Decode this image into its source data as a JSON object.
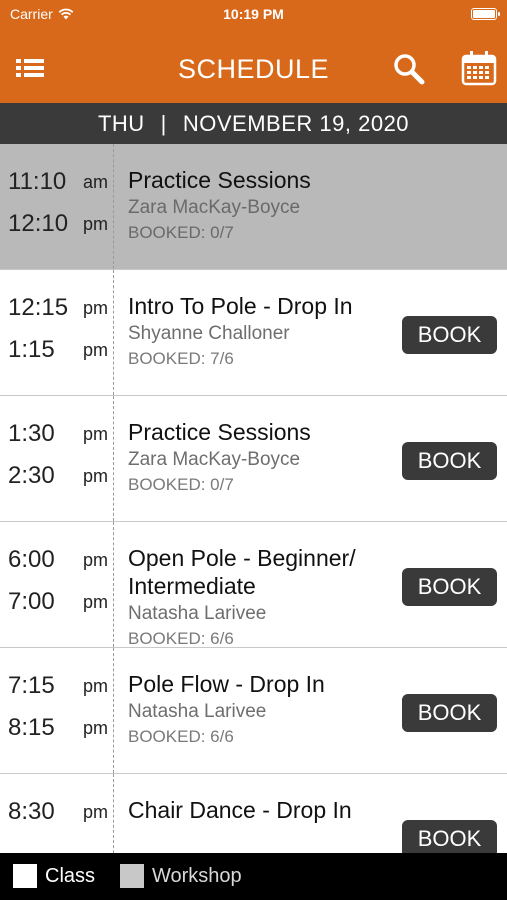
{
  "status": {
    "carrier": "Carrier",
    "time": "10:19 PM"
  },
  "header": {
    "title": "SCHEDULE",
    "icons": [
      "menu-icon",
      "search-icon",
      "calendar-icon"
    ]
  },
  "date": {
    "day": "THU",
    "separator": "|",
    "full": "NOVEMBER 19, 2020"
  },
  "classes": [
    {
      "start": "11:10",
      "start_ap": "am",
      "end": "12:10",
      "end_ap": "pm",
      "name": "Practice Sessions",
      "instructor": "Zara MacKay-Boyce",
      "booked": "BOOKED: 0/7",
      "button": "",
      "highlighted": true
    },
    {
      "start": "12:15",
      "start_ap": "pm",
      "end": "1:15",
      "end_ap": "pm",
      "name": "Intro To Pole - Drop In",
      "instructor": "Shyanne Challoner",
      "booked": "BOOKED: 7/6",
      "button": "BOOK"
    },
    {
      "start": "1:30",
      "start_ap": "pm",
      "end": "2:30",
      "end_ap": "pm",
      "name": "Practice Sessions",
      "instructor": "Zara MacKay-Boyce",
      "booked": "BOOKED: 0/7",
      "button": "BOOK"
    },
    {
      "start": "6:00",
      "start_ap": "pm",
      "end": "7:00",
      "end_ap": "pm",
      "name": "Open Pole - Beginner/ Intermediate",
      "instructor": "Natasha Larivee",
      "booked": "BOOKED: 6/6",
      "button": "BOOK"
    },
    {
      "start": "7:15",
      "start_ap": "pm",
      "end": "8:15",
      "end_ap": "pm",
      "name": "Pole Flow - Drop In",
      "instructor": "Natasha Larivee",
      "booked": "BOOKED: 6/6",
      "button": "BOOK"
    },
    {
      "start": "8:30",
      "start_ap": "pm",
      "end": "",
      "end_ap": "",
      "name": "Chair Dance - Drop In",
      "instructor": "",
      "booked": "",
      "button": "BOOK"
    }
  ],
  "legend": [
    {
      "label": "Class",
      "color": "#ffffff"
    },
    {
      "label": "Workshop",
      "color": "#c8c8c8"
    }
  ],
  "colors": {
    "accent": "#d9691a",
    "datebar": "#3a3a3a",
    "highlight_row": "#b9b9b9"
  }
}
